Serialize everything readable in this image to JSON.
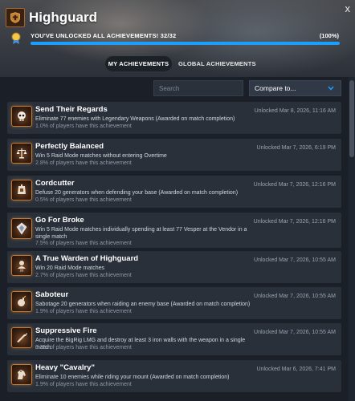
{
  "header": {
    "game_title": "Highguard",
    "close_glyph": "x",
    "progress_text": "YOU'VE UNLOCKED ALL ACHIEVEMENTS! 32/32",
    "progress_percent_label": "(100%)",
    "progress_fraction": 1.0
  },
  "tabs": [
    {
      "label": "MY ACHIEVEMENTS",
      "active": true
    },
    {
      "label": "GLOBAL ACHIEVEMENTS",
      "active": false
    }
  ],
  "filters": {
    "search_placeholder": "Search",
    "compare_label": "Compare to..."
  },
  "achievements": [
    {
      "title": "Send Their Regards",
      "description": "Eliminate 77 enemies with Legendary Weapons (Awarded on match completion)",
      "percent": "1.0% of players have this achievement",
      "unlocked": "Unlocked Mar 8, 2026, 11:16 AM",
      "icon": "skull-icon"
    },
    {
      "title": "Perfectly Balanced",
      "description": "Win 5 Raid Mode matches without entering Overtime",
      "percent": "2.8% of players have this achievement",
      "unlocked": "Unlocked Mar 7, 2026, 6:19 PM",
      "icon": "scales-icon"
    },
    {
      "title": "Cordcutter",
      "description": "Defuse 20 generators when defending your base (Awarded on match completion)",
      "percent": "0.5% of players have this achievement",
      "unlocked": "Unlocked Mar 7, 2026, 12:16 PM",
      "icon": "generator-icon"
    },
    {
      "title": "Go For Broke",
      "description": "Win 5 Raid Mode matches individually spending at least 77 Vesper at the Vendor in a single match",
      "percent": "7.5% of players have this achievement",
      "unlocked": "Unlocked Mar 7, 2026, 12:16 PM",
      "icon": "gem-icon"
    },
    {
      "title": "A True Warden of Highguard",
      "description": "Win 20 Raid Mode matches",
      "percent": "2.7% of players have this achievement",
      "unlocked": "Unlocked Mar 7, 2026, 10:55 AM",
      "icon": "warden-icon",
      "badge_text": "20"
    },
    {
      "title": "Saboteur",
      "description": "Sabotage 20 generators when raiding an enemy base (Awarded on match completion)",
      "percent": "1.9% of players have this achievement",
      "unlocked": "Unlocked Mar 7, 2026, 10:55 AM",
      "icon": "bomb-icon"
    },
    {
      "title": "Suppressive Fire",
      "description": "Acquire the BigRig LMG and destroy at least 3 iron walls with the weapon in a single match",
      "percent": "0.3% of players have this achievement",
      "unlocked": "Unlocked Mar 7, 2026, 10:55 AM",
      "icon": "gun-icon"
    },
    {
      "title": "Heavy \"Cavalry\"",
      "description": "Eliminate 10 enemies while riding your mount (Awarded on match completion)",
      "percent": "1.9% of players have this achievement",
      "unlocked": "Unlocked Mar 6, 2026, 7:41 PM",
      "icon": "horse-icon"
    }
  ],
  "colors": {
    "accent": "#1a9fff",
    "badge_border": "#c07a32",
    "row_bg": "#2a303a",
    "page_bg": "#1b2028"
  }
}
